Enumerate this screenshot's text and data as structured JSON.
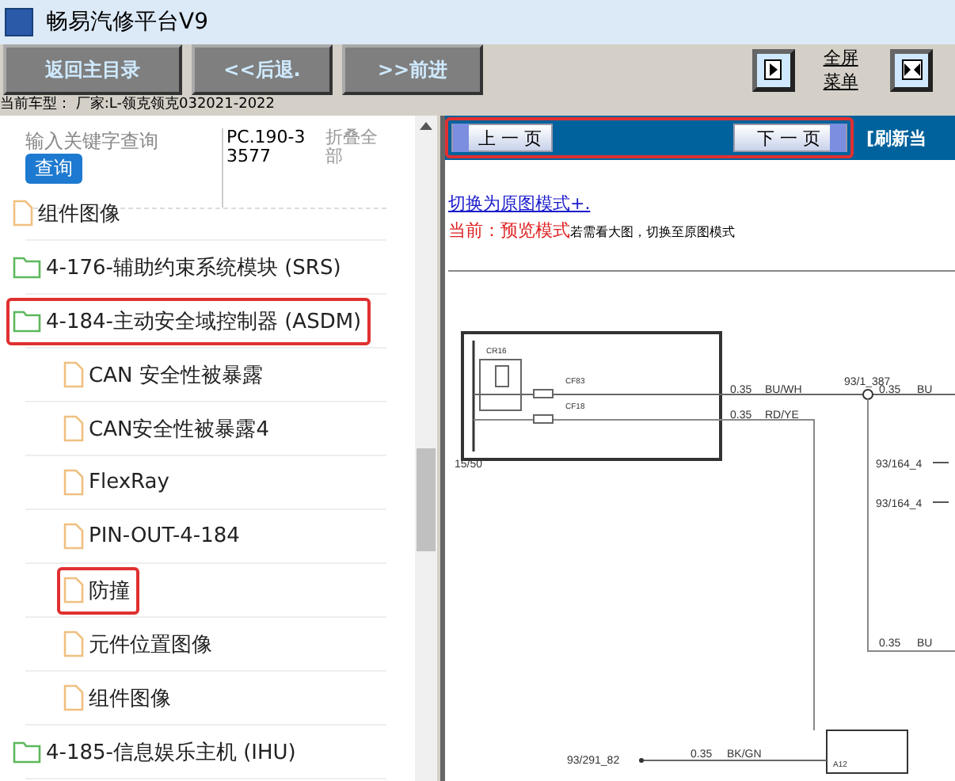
{
  "window": {
    "title": "畅易汽修平台V9"
  },
  "toolbar": {
    "buttons": [
      "返回主目录",
      "<<后退.",
      ">>前进"
    ],
    "fullscreen_menu": "全屏菜单"
  },
  "car_info": "当前车型： 厂家:L-领克领克032021-2022",
  "sidebar": {
    "search": {
      "placeholder": "输入关键字查询"
    },
    "search_button": "查询",
    "code": "PC.190-33577",
    "collapse_all": "折叠全部",
    "tree": [
      {
        "label": "组件图像",
        "kind": "file",
        "highlighted": false
      },
      {
        "label": "4-176-辅助约束系统模块 (SRS)",
        "kind": "folder",
        "highlighted": false
      },
      {
        "label": "4-184-主动安全域控制器 (ASDM)",
        "kind": "folder",
        "highlighted": true,
        "children": [
          {
            "label": "CAN 安全性被暴露",
            "kind": "file",
            "highlighted": false
          },
          {
            "label": "CAN安全性被暴露4",
            "kind": "file",
            "highlighted": false
          },
          {
            "label": "FlexRay",
            "kind": "file",
            "highlighted": false
          },
          {
            "label": "PIN-OUT-4-184",
            "kind": "file",
            "highlighted": false
          },
          {
            "label": "防撞",
            "kind": "file",
            "highlighted": true
          },
          {
            "label": "元件位置图像",
            "kind": "file",
            "highlighted": false
          },
          {
            "label": "组件图像",
            "kind": "file",
            "highlighted": false
          }
        ]
      },
      {
        "label": "4-185-信息娱乐主机 (IHU)",
        "kind": "folder",
        "highlighted": false
      }
    ]
  },
  "viewer": {
    "prev_page": "上 一 页",
    "next_page": "下 一 页",
    "refresh": "[刷新当",
    "nav_highlighted": true,
    "switch_link": "切换为原图模式+.",
    "mode_notice": "当前：预览模式",
    "mode_hint": "若需看大图，切换至原图模式",
    "diagram_labels": [
      "CR16",
      "CF83",
      "CF18",
      "0.35",
      "BU/WH",
      "0.35",
      "RD/YE",
      "93/1_387",
      "0.35",
      "BU",
      "15/50",
      "93/164_4",
      "93/164_4",
      "0.35",
      "BU",
      "93/291_82",
      "0.35",
      "BK/GN",
      "A12"
    ]
  }
}
